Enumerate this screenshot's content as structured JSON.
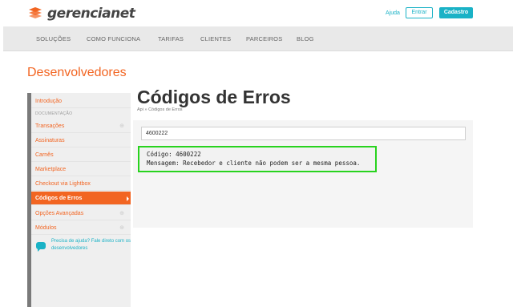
{
  "header": {
    "logo_text": "gerencianet",
    "help_link": "Ajuda",
    "login_button": "Entrar",
    "signup_button": "Cadastro"
  },
  "nav": {
    "items": [
      "SOLUÇÕES",
      "COMO FUNCIONA",
      "TARIFAS",
      "CLIENTES",
      "PARCEIROS",
      "BLOG"
    ]
  },
  "section_title": "Desenvolvedores",
  "page": {
    "title": "Códigos de Erros",
    "breadcrumb": "Api »  Códigos de Erros"
  },
  "sidebar": {
    "intro": "Introdução",
    "section_label": "DOCUMENTAÇÃO",
    "items": [
      {
        "label": "Transações",
        "expandable": true
      },
      {
        "label": "Assinaturas",
        "expandable": false
      },
      {
        "label": "Carnês",
        "expandable": false
      },
      {
        "label": "Marketplace",
        "expandable": false
      },
      {
        "label": "Checkout via Lightbox",
        "expandable": false
      },
      {
        "label": "Códigos de Erros",
        "active": true
      },
      {
        "label": "Opções Avançadas",
        "expandable": true
      },
      {
        "label": "Módulos",
        "expandable": true
      }
    ],
    "help_text": "Precisa de ajuda? Fale direto com os desenvolvedores"
  },
  "search": {
    "value": "4600222"
  },
  "result": {
    "code_line": "Código: 4600222",
    "message_line": "Mensagem: Recebedor e cliente não podem ser a mesma pessoa."
  },
  "colors": {
    "brand_orange": "#f26522",
    "accent_teal": "#1ab2c6",
    "highlight_green": "#28d31e"
  }
}
